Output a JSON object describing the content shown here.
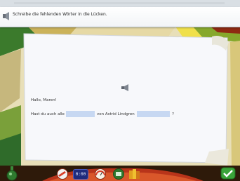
{
  "instruction": {
    "text": "Schreibe die fehlenden Wörter in die Lücken.",
    "icon": "speaker-icon"
  },
  "exercise": {
    "greeting": "Hallo, Maren!",
    "sentence_parts": [
      "Hast du auch alle",
      "von Astrid Lindgren",
      "?"
    ],
    "gaps": [
      {
        "value": "",
        "placeholder": ""
      },
      {
        "value": "",
        "placeholder": ""
      }
    ],
    "speaker_icon": "speaker-icon"
  },
  "toolbar": {
    "clock_text": "0:00",
    "items": [
      "pencil-icon",
      "clock-icon",
      "speedometer-icon",
      "save-icon",
      "book-icon",
      "check-icon"
    ]
  },
  "colors": {
    "instruction_bg": "#ffffff",
    "gap_fill": "#c7d8f2",
    "paper": "#f7f8fb",
    "grass": "#2f6b2a",
    "path": "#c83d17",
    "confirm": "#3aa43a"
  }
}
